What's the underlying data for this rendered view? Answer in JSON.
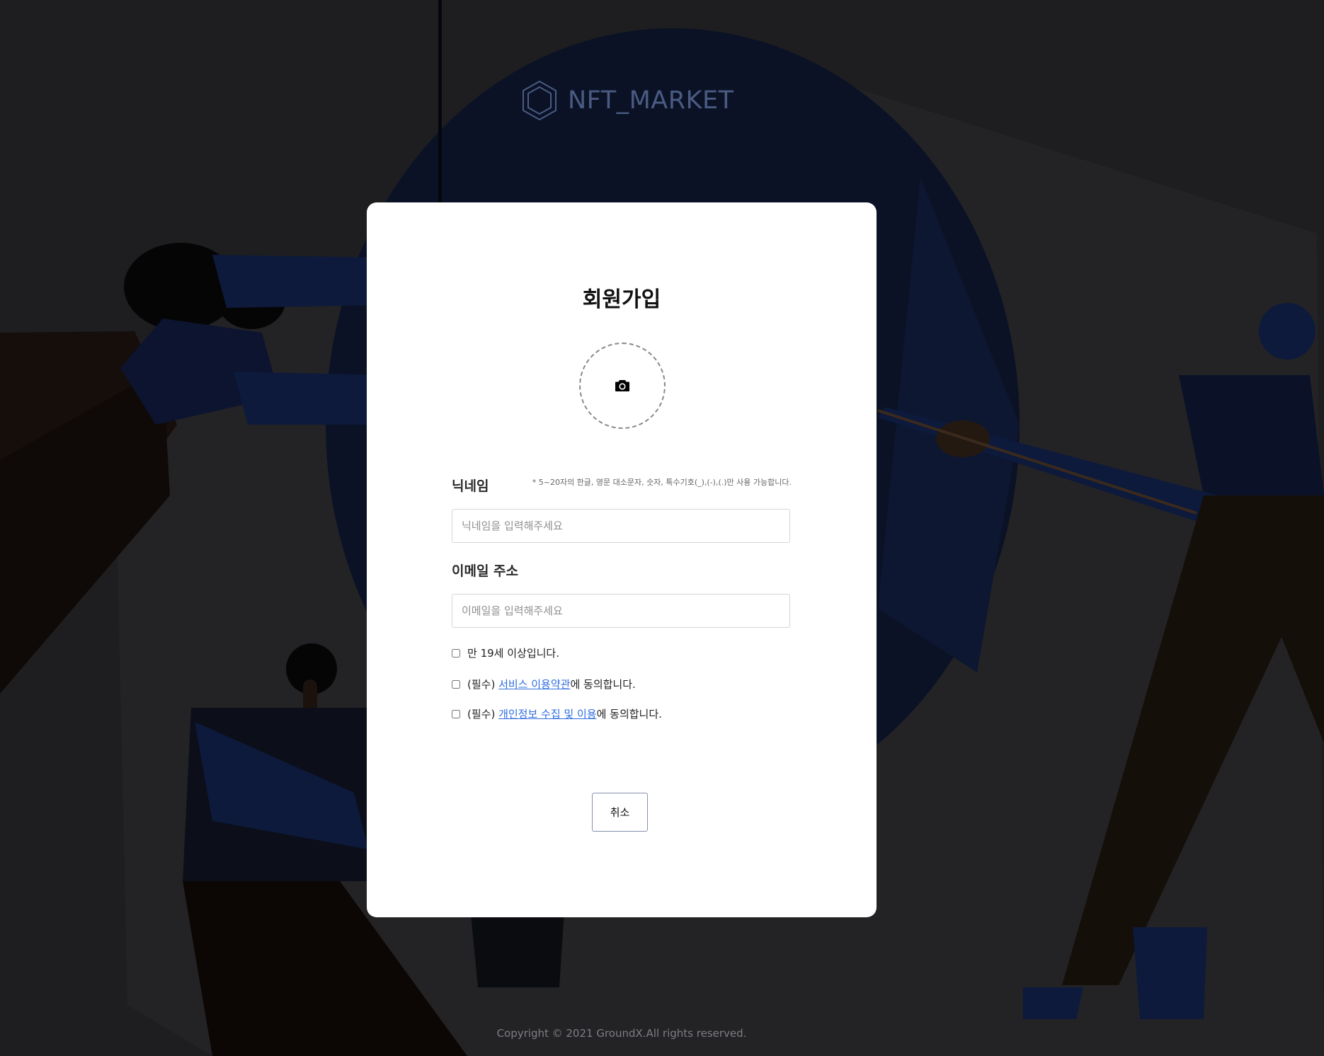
{
  "brand": {
    "name": "NFT_MARKET"
  },
  "signup": {
    "title": "회원가입",
    "nickname_label": "닉네임",
    "nickname_hint": "* 5~20자의 한글, 영문 대소문자, 숫자, 특수기호(_),(-),(.)만 사용 가능합니다.",
    "nickname_placeholder": "닉네임을 입력해주세요",
    "email_label": "이메일 주소",
    "email_placeholder": "이메일을 입력해주세요",
    "age_check": "만 19세 이상입니다.",
    "terms_prefix": "(필수) ",
    "terms_link": "서비스 이용약관",
    "terms_suffix": "에 동의합니다.",
    "privacy_prefix": "(필수) ",
    "privacy_link": "개인정보 수집 및 이용",
    "privacy_suffix": "에 동의합니다.",
    "cancel_label": "취소"
  },
  "footer": {
    "copyright": "Copyright © 2021 GroundX.All rights reserved."
  },
  "colors": {
    "accent": "#2f6de0",
    "brand": "#4a5b82",
    "background": "#1e1e20"
  },
  "icons": {
    "avatar_upload": "camera-icon",
    "logo": "hexagon-logo-icon"
  }
}
